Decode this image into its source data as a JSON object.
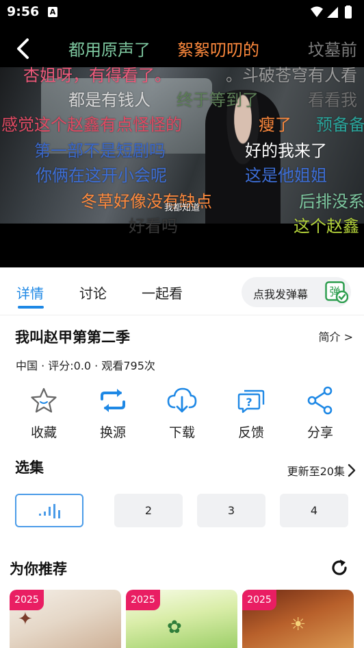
{
  "status_bar": {
    "time": "9:56",
    "notification_glyph": "A"
  },
  "player": {
    "subtitle": "我都知道",
    "danmaku": [
      {
        "text": "都用原声了",
        "color": "#7ec8a0"
      },
      {
        "text": "絮絮叨叨的",
        "color": "#ff8a3d"
      },
      {
        "text": "坟墓前",
        "color": "#7c7c7c"
      },
      {
        "text": "杏姐呀，有得看了。",
        "color": "#ef5a7b"
      },
      {
        "text": "。斗破苍穹有人看",
        "color": "#9a9a9a"
      },
      {
        "text": "都是有钱人",
        "color": "#d9d9d9"
      },
      {
        "text": "终于等到了",
        "color": "#5c7e56"
      },
      {
        "text": "看看我",
        "color": "#6f6f6f"
      },
      {
        "text": "感觉这个赵鑫有点怪怪的",
        "color": "#e14a63"
      },
      {
        "text": "瘦了",
        "color": "#ff8a3d"
      },
      {
        "text": "预备备",
        "color": "#2aa39a"
      },
      {
        "text": "第一部不是短剧吗",
        "color": "#3a67c9"
      },
      {
        "text": "好的我来了",
        "color": "#ffffff"
      },
      {
        "text": "你俩在这开小会呢",
        "color": "#3d6ed6"
      },
      {
        "text": "这是他姐姐",
        "color": "#3d6ed6"
      },
      {
        "text": "冬草好像没有缺点",
        "color": "#ff8a3d"
      },
      {
        "text": "后排没系",
        "color": "#7ec8a0"
      },
      {
        "text": "好看吗",
        "color": "#3a3a3a"
      },
      {
        "text": "这个赵鑫",
        "color": "#b4d33a"
      }
    ]
  },
  "tabs": [
    {
      "label": "详情",
      "active": true
    },
    {
      "label": "讨论",
      "active": false
    },
    {
      "label": "一起看",
      "active": false
    }
  ],
  "danmaku_send": {
    "label": "点我发弹幕",
    "switch_glyph": "弹"
  },
  "detail": {
    "title": "我叫赵甲第第二季",
    "intro_link": "简介 >",
    "meta": "中国 · 评分:0.0 · 观看795次"
  },
  "actions": [
    {
      "label": "收藏",
      "icon": "star-icon"
    },
    {
      "label": "换源",
      "icon": "switch-source-icon"
    },
    {
      "label": "下载",
      "icon": "download-icon"
    },
    {
      "label": "反馈",
      "icon": "feedback-icon"
    },
    {
      "label": "分享",
      "icon": "share-icon"
    }
  ],
  "episodes_section": {
    "title": "选集",
    "update_link": "更新至20集",
    "episodes": [
      {
        "label": "",
        "current": true,
        "icon": "playing-bars-icon"
      },
      {
        "label": "2",
        "current": false
      },
      {
        "label": "3",
        "current": false
      },
      {
        "label": "4",
        "current": false
      }
    ]
  },
  "recommend": {
    "title": "为你推荐",
    "cards": [
      {
        "badge": "2025"
      },
      {
        "badge": "2025"
      },
      {
        "badge": "2025"
      }
    ]
  },
  "colors": {
    "accent": "#1e88e5",
    "badge": "#e91e63"
  }
}
